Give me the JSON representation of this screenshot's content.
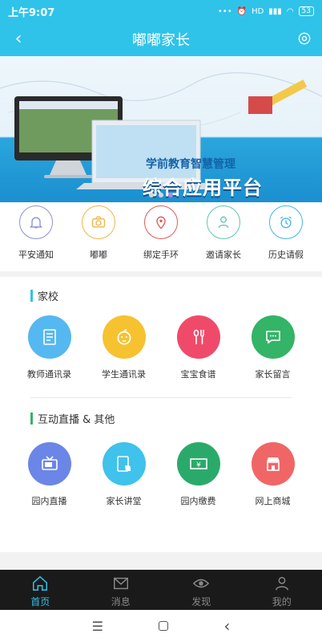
{
  "status": {
    "time": "上午9:07",
    "signal_text": "HD",
    "battery": "53"
  },
  "header": {
    "title": "嘟嘟家长"
  },
  "banner": {
    "subtitle": "学前教育智慧管理",
    "title": "综合应用平台",
    "page_count": 3,
    "active_page": 3
  },
  "quick": [
    {
      "label": "平安通知",
      "icon": "bell-icon",
      "color": "#8f8fd8"
    },
    {
      "label": "嘟嘟",
      "icon": "camera-icon",
      "color": "#f0b54a"
    },
    {
      "label": "绑定手环",
      "icon": "location-pin-icon",
      "color": "#e05a5a"
    },
    {
      "label": "邀请家长",
      "icon": "person-icon",
      "color": "#5cc6b0"
    },
    {
      "label": "历史请假",
      "icon": "alarm-clock-icon",
      "color": "#3fb8e0"
    }
  ],
  "sections": [
    {
      "title": "家校",
      "items": [
        {
          "label": "教师通讯录",
          "icon": "document-icon",
          "color": "#55b8f0"
        },
        {
          "label": "学生通讯录",
          "icon": "child-face-icon",
          "color": "#f6c230"
        },
        {
          "label": "宝宝食谱",
          "icon": "spoon-fork-icon",
          "color": "#f04a6a"
        },
        {
          "label": "家长留言",
          "icon": "chat-bubble-icon",
          "color": "#33b466"
        }
      ]
    },
    {
      "title": "互动直播 & 其他",
      "items": [
        {
          "label": "园内直播",
          "icon": "tv-icon",
          "color": "#6b86e6"
        },
        {
          "label": "家长讲堂",
          "icon": "tablet-touch-icon",
          "color": "#3fc2ec"
        },
        {
          "label": "园内缴费",
          "icon": "money-icon",
          "color": "#2aaa6a"
        },
        {
          "label": "网上商城",
          "icon": "shop-icon",
          "color": "#f06666"
        }
      ]
    }
  ],
  "tabbar": [
    {
      "label": "首页",
      "icon": "home-icon",
      "active": true
    },
    {
      "label": "消息",
      "icon": "mail-icon",
      "active": false
    },
    {
      "label": "发现",
      "icon": "eye-icon",
      "active": false
    },
    {
      "label": "我的",
      "icon": "user-icon",
      "active": false
    }
  ]
}
